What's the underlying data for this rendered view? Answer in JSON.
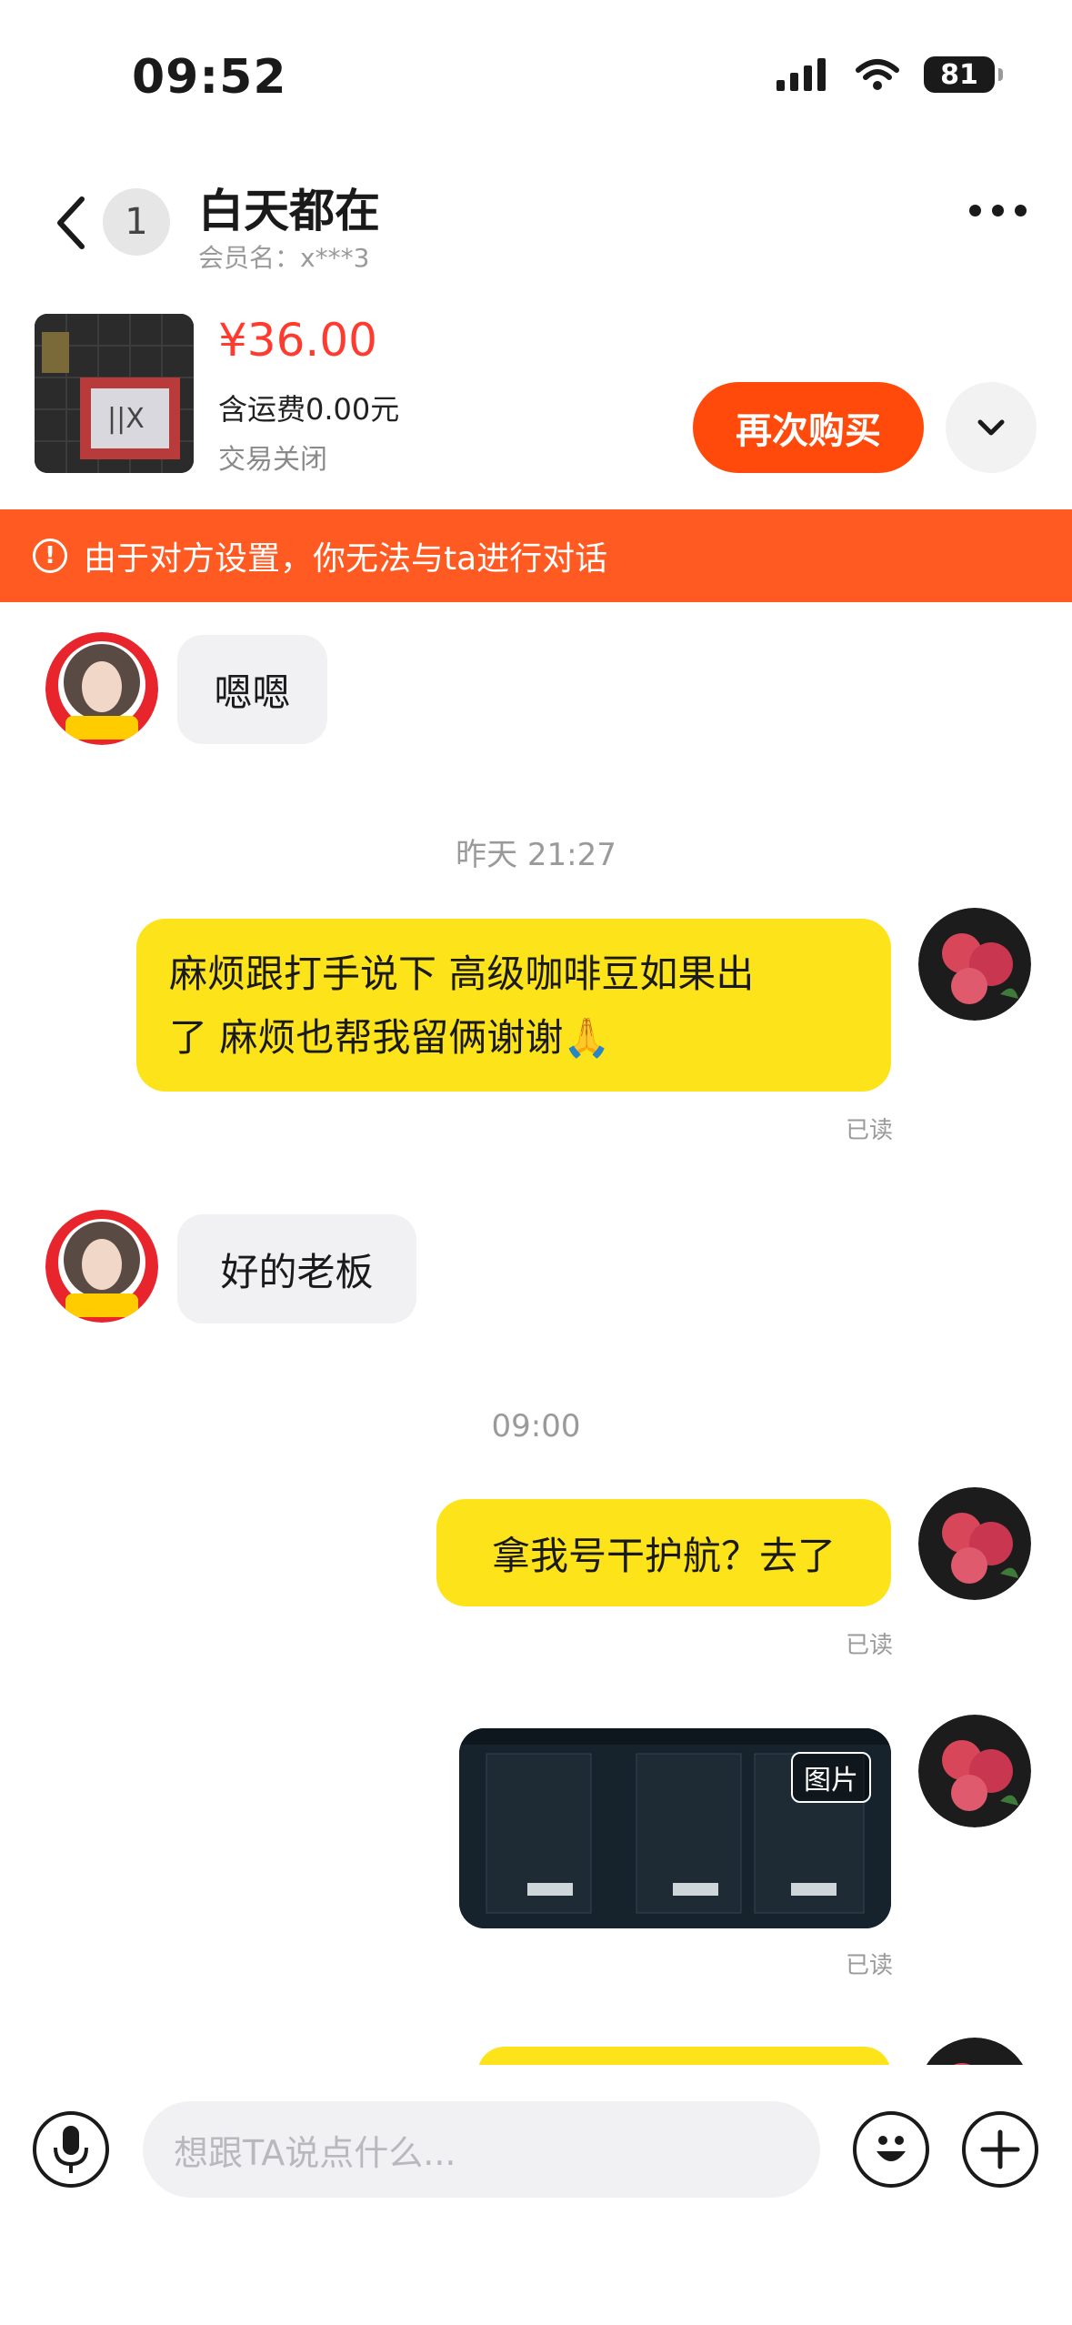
{
  "status_bar": {
    "time": "09:52",
    "battery": "81"
  },
  "header": {
    "unread_count": "1",
    "name": "白天都在",
    "member": "会员名：x***3"
  },
  "product": {
    "price": "¥36.00",
    "shipping": "含运费0.00元",
    "status": "交易关闭",
    "rebuy_label": "再次购买"
  },
  "banner": {
    "text": "由于对方设置，你无法与ta进行对话"
  },
  "messages": {
    "m1": {
      "text": "嗯嗯"
    },
    "ts1": "昨天 21:27",
    "m2": {
      "line1": "麻烦跟打手说下 高级咖啡豆如果出",
      "line2": "了 麻烦也帮我留俩谢谢🙏",
      "read": "已读"
    },
    "m3": {
      "text": "好的老板"
    },
    "ts2": "09:00",
    "m4": {
      "text": "拿我号干护航？去了",
      "read": "已读"
    },
    "m5": {
      "image_tag": "图片",
      "read": "已读"
    }
  },
  "input": {
    "placeholder": "想跟TA说点什么..."
  },
  "colors": {
    "accent": "#ff4a0c",
    "banner": "#ff5a21",
    "bubble_self": "#fde41a",
    "price": "#ff3b30"
  }
}
